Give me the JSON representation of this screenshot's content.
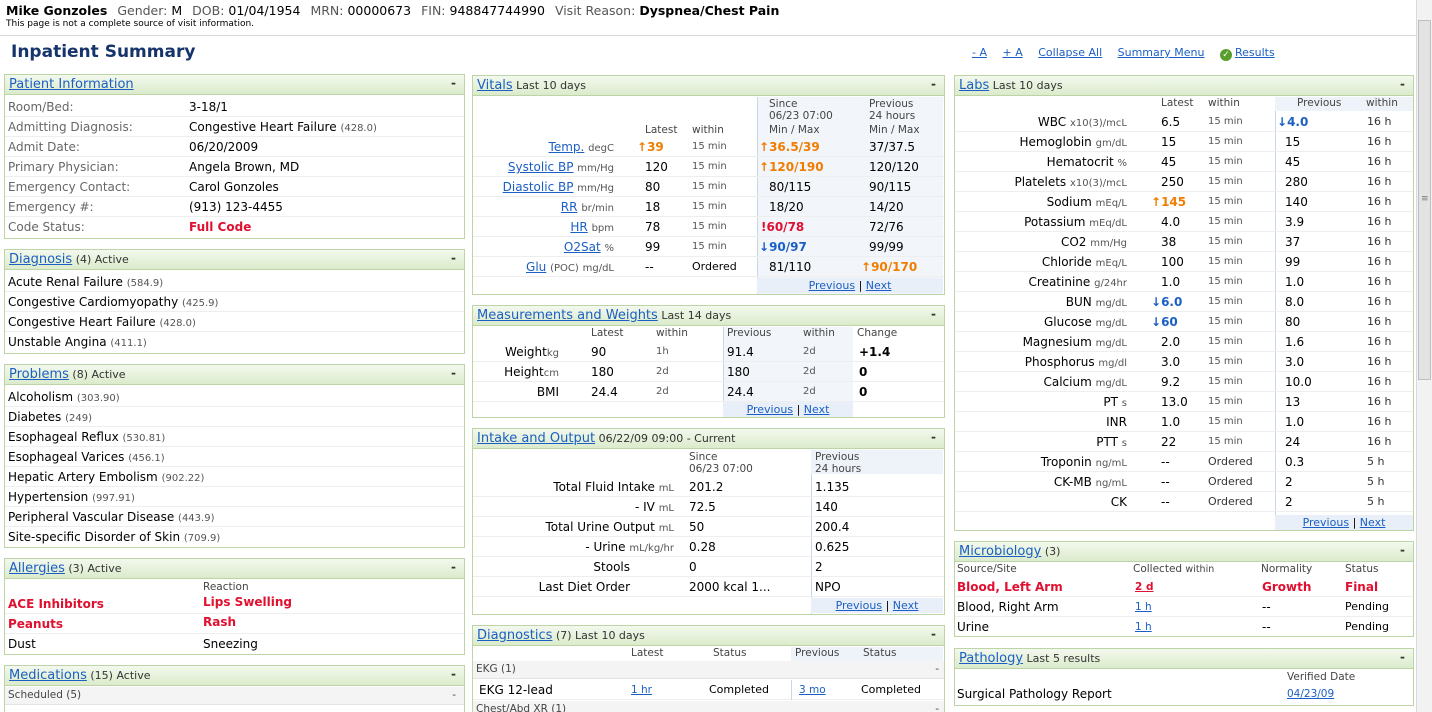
{
  "banner": {
    "name": "Mike Gonzoles",
    "gender_label": "Gender:",
    "gender": "M",
    "dob_label": "DOB:",
    "dob": "01/04/1954",
    "mrn_label": "MRN:",
    "mrn": "00000673",
    "fin_label": "FIN:",
    "fin": "948847744990",
    "reason_label": "Visit Reason:",
    "reason": "Dyspnea/Chest Pain",
    "note": "This page is not a complete source of visit information."
  },
  "page": {
    "title": "Inpatient Summary",
    "links": {
      "dec": "- A",
      "inc": "+ A",
      "collapse": "Collapse All",
      "menu": "Summary Menu",
      "results": "Results"
    }
  },
  "patient_info": {
    "title": "Patient Information",
    "minimize": "-",
    "rows": [
      {
        "label": "Room/Bed:",
        "value": "3-18/1",
        "code": ""
      },
      {
        "label": "Admitting Diagnosis:",
        "value": "Congestive Heart Failure",
        "code": "(428.0)"
      },
      {
        "label": "Admit Date:",
        "value": "06/20/2009",
        "code": ""
      },
      {
        "label": "Primary Physician:",
        "value": "Angela Brown, MD",
        "code": ""
      },
      {
        "label": "Emergency Contact:",
        "value": "Carol Gonzoles",
        "code": ""
      },
      {
        "label": "Emergency #:",
        "value": "(913) 123-4455",
        "code": ""
      },
      {
        "label": "Code Status:",
        "value": "Full Code",
        "code": ""
      }
    ]
  },
  "diagnosis": {
    "title": "Diagnosis",
    "count": "(4)",
    "status": "Active",
    "minimize": "-",
    "items": [
      {
        "name": "Acute Renal Failure",
        "code": "(584.9)"
      },
      {
        "name": "Congestive Cardiomyopathy",
        "code": "(425.9)"
      },
      {
        "name": "Congestive Heart Failure",
        "code": "(428.0)"
      },
      {
        "name": "Unstable Angina",
        "code": "(411.1)"
      }
    ]
  },
  "problems": {
    "title": "Problems",
    "count": "(8)",
    "status": "Active",
    "minimize": "-",
    "items": [
      {
        "name": "Alcoholism",
        "code": "(303.90)"
      },
      {
        "name": "Diabetes",
        "code": "(249)"
      },
      {
        "name": "Esophageal Reflux",
        "code": "(530.81)"
      },
      {
        "name": "Esophageal Varices",
        "code": "(456.1)"
      },
      {
        "name": "Hepatic Artery Embolism",
        "code": "(902.22)"
      },
      {
        "name": "Hypertension",
        "code": "(997.91)"
      },
      {
        "name": "Peripheral Vascular Disease",
        "code": "(443.9)"
      },
      {
        "name": "Site-specific Disorder of Skin",
        "code": "(709.9)"
      }
    ]
  },
  "allergies": {
    "title": "Allergies",
    "count": "(3)",
    "status": "Active",
    "minimize": "-",
    "reaction_header": "Reaction",
    "items": [
      {
        "name": "ACE Inhibitors",
        "reaction": "Lips Swelling"
      },
      {
        "name": "Peanuts",
        "reaction": "Rash"
      },
      {
        "name": "Dust",
        "reaction": "Sneezing"
      }
    ]
  },
  "medications": {
    "title": "Medications",
    "count": "(15)",
    "status": "Active",
    "minimize": "-",
    "sub": "Scheduled (5)",
    "sub_minimize": "-"
  },
  "vitals": {
    "title": "Vitals",
    "range": "Last 10 days",
    "minimize": "-",
    "hdr": {
      "since": "Since",
      "since_date": "06/23 07:00",
      "prev": "Previous",
      "prev_range": "24 hours",
      "latest": "Latest",
      "within": "within",
      "minmax": "Min / Max",
      "minmax2": "Min / Max"
    },
    "rows": [
      {
        "name": "Temp.",
        "unit": "degC",
        "latest": "39",
        "within": "15 min",
        "since": "36.5/39",
        "prev": "37/37.5"
      },
      {
        "name": "Systolic BP",
        "unit": "mm/Hg",
        "latest": "120",
        "within": "15 min",
        "since": "120/190",
        "prev": "120/120"
      },
      {
        "name": "Diastolic BP",
        "unit": "mm/Hg",
        "latest": "80",
        "within": "15 min",
        "since": "80/115",
        "prev": "90/115"
      },
      {
        "name": "RR",
        "unit": "br/min",
        "latest": "18",
        "within": "15 min",
        "since": "18/20",
        "prev": "14/20"
      },
      {
        "name": "HR",
        "unit": "bpm",
        "latest": "78",
        "within": "15 min",
        "since": "60/78",
        "prev": "72/76"
      },
      {
        "name": "O2Sat",
        "unit": "%",
        "latest": "99",
        "within": "15 min",
        "since": "90/97",
        "prev": "99/99"
      },
      {
        "name": "Glu",
        "unit2": "(POC)",
        "unit": "mg/dL",
        "latest": "--",
        "within": "Ordered",
        "since": "81/110",
        "prev": "90/170"
      }
    ],
    "pager": {
      "prev": "Previous",
      "sep": "|",
      "next": "Next"
    }
  },
  "measurements": {
    "title": "Measurements and Weights",
    "range": "Last 14 days",
    "minimize": "-",
    "hdr": {
      "latest": "Latest",
      "within": "within",
      "prev": "Previous",
      "within2": "within",
      "change": "Change"
    },
    "rows": [
      {
        "name": "Weight",
        "unit": "kg",
        "latest": "90",
        "within": "1h",
        "prev": "91.4",
        "within2": "2d",
        "change": "+1.4"
      },
      {
        "name": "Height",
        "unit": "cm",
        "latest": "180",
        "within": "2d",
        "prev": "180",
        "within2": "2d",
        "change": "0"
      },
      {
        "name": "BMI",
        "unit": "",
        "latest": "24.4",
        "within": "2d",
        "prev": "24.4",
        "within2": "2d",
        "change": "0"
      }
    ],
    "pager": {
      "prev": "Previous",
      "sep": "|",
      "next": "Next"
    }
  },
  "intake": {
    "title": "Intake and Output",
    "range": "06/22/09 09:00 - Current",
    "minimize": "-",
    "hdr": {
      "since": "Since",
      "since_date": "06/23 07:00",
      "prev": "Previous",
      "prev_range": "24 hours"
    },
    "rows": [
      {
        "name": "Total Fluid Intake",
        "unit": "mL",
        "since": "201.2",
        "prev": "1.135"
      },
      {
        "name": "- IV",
        "unit": "mL",
        "since": "72.5",
        "prev": "140"
      },
      {
        "name": "Total Urine Output",
        "unit": "mL",
        "since": "50",
        "prev": "200.4"
      },
      {
        "name": "- Urine",
        "unit": "mL/kg/hr",
        "since": "0.28",
        "prev": "0.625"
      },
      {
        "name": "Stools",
        "unit": "",
        "since": "0",
        "prev": "2"
      },
      {
        "name": "Last Diet Order",
        "unit": "",
        "since": "2000 kcal 1...",
        "prev": "NPO"
      }
    ],
    "pager": {
      "prev": "Previous",
      "sep": "|",
      "next": "Next"
    }
  },
  "diagnostics": {
    "title": "Diagnostics",
    "count": "(7)",
    "range": "Last 10 days",
    "minimize": "-",
    "hdr": {
      "latest": "Latest",
      "status": "Status",
      "prev": "Previous",
      "status2": "Status"
    },
    "group1": "EKG (1)",
    "group1_min": "-",
    "row": {
      "name": "EKG 12-lead",
      "latest": "1 hr",
      "status": "Completed",
      "prev": "3 mo",
      "status2": "Completed"
    },
    "group2": "Chest/Abd XR (1)",
    "group2_min": "-"
  },
  "labs": {
    "title": "Labs",
    "range": "Last 10 days",
    "minimize": "-",
    "hdr": {
      "latest": "Latest",
      "within": "within",
      "prev": "Previous",
      "within2": "within"
    },
    "rows": [
      {
        "name": "WBC",
        "unit": "x10(3)/mcL",
        "latest": "6.5",
        "within": "15 min",
        "prev": "4.0",
        "within2": "16 h"
      },
      {
        "name": "Hemoglobin",
        "unit": "gm/dL",
        "latest": "15",
        "within": "15 min",
        "prev": "15",
        "within2": "16 h"
      },
      {
        "name": "Hematocrit",
        "unit": "%",
        "latest": "45",
        "within": "15 min",
        "prev": "45",
        "within2": "16 h"
      },
      {
        "name": "Platelets",
        "unit": "x10(3)/mcL",
        "latest": "250",
        "within": "15 min",
        "prev": "280",
        "within2": "16 h"
      },
      {
        "name": "Sodium",
        "unit": "mEq/L",
        "latest": "145",
        "within": "15 min",
        "prev": "140",
        "within2": "16 h"
      },
      {
        "name": "Potassium",
        "unit": "mEq/dL",
        "latest": "4.0",
        "within": "15 min",
        "prev": "3.9",
        "within2": "16 h"
      },
      {
        "name": "CO2",
        "unit": "mm/Hg",
        "latest": "38",
        "within": "15 min",
        "prev": "37",
        "within2": "16 h"
      },
      {
        "name": "Chloride",
        "unit": "mEq/L",
        "latest": "100",
        "within": "15 min",
        "prev": "99",
        "within2": "16 h"
      },
      {
        "name": "Creatinine",
        "unit": "g/24hr",
        "latest": "1.0",
        "within": "15 min",
        "prev": "1.0",
        "within2": "16 h"
      },
      {
        "name": "BUN",
        "unit": "mg/dL",
        "latest": "6.0",
        "within": "15 min",
        "prev": "8.0",
        "within2": "16 h"
      },
      {
        "name": "Glucose",
        "unit": "mg/dL",
        "latest": "60",
        "within": "15 min",
        "prev": "80",
        "within2": "16 h"
      },
      {
        "name": "Magnesium",
        "unit": "mg/dL",
        "latest": "2.0",
        "within": "15 min",
        "prev": "1.6",
        "within2": "16 h"
      },
      {
        "name": "Phosphorus",
        "unit": "mg/dl",
        "latest": "3.0",
        "within": "15 min",
        "prev": "3.0",
        "within2": "16 h"
      },
      {
        "name": "Calcium",
        "unit": "mg/dL",
        "latest": "9.2",
        "within": "15 min",
        "prev": "10.0",
        "within2": "16 h"
      },
      {
        "name": "PT",
        "unit": "s",
        "latest": "13.0",
        "within": "15 min",
        "prev": "13",
        "within2": "16 h"
      },
      {
        "name": "INR",
        "unit": "",
        "latest": "1.0",
        "within": "15 min",
        "prev": "1.0",
        "within2": "16 h"
      },
      {
        "name": "PTT",
        "unit": "s",
        "latest": "22",
        "within": "15 min",
        "prev": "24",
        "within2": "16 h"
      },
      {
        "name": "Troponin",
        "unit": "ng/mL",
        "latest": "--",
        "within": "Ordered",
        "prev": "0.3",
        "within2": "5 h"
      },
      {
        "name": "CK-MB",
        "unit": "ng/mL",
        "latest": "--",
        "within": "Ordered",
        "prev": "2",
        "within2": "5 h"
      },
      {
        "name": "CK",
        "unit": "",
        "latest": "--",
        "within": "Ordered",
        "prev": "2",
        "within2": "5 h"
      }
    ],
    "pager": {
      "prev": "Previous",
      "sep": "|",
      "next": "Next"
    }
  },
  "micro": {
    "title": "Microbiology",
    "count": "(3)",
    "minimize": "-",
    "hdr": {
      "source": "Source/Site",
      "collected": "Collected",
      "within": "within",
      "normality": "Normality",
      "status": "Status"
    },
    "rows": [
      {
        "source": "Blood, Left Arm",
        "collected": "2 d",
        "normality": "Growth",
        "status": "Final"
      },
      {
        "source": "Blood, Right Arm",
        "collected": "1 h",
        "normality": "--",
        "status": "Pending"
      },
      {
        "source": "Urine",
        "collected": "1 h",
        "normality": "--",
        "status": "Pending"
      }
    ]
  },
  "pathology": {
    "title": "Pathology",
    "range": "Last 5 results",
    "minimize": "-",
    "hdr_verified": "Verified Date",
    "row": {
      "name": "Surgical Pathology Report",
      "date": "04/23/09"
    }
  },
  "colors": {
    "abnormal_red": "#e01030",
    "high_orange": "#f07d00",
    "low_blue": "#1b5fc4",
    "panel_green": "#dbebcb"
  }
}
